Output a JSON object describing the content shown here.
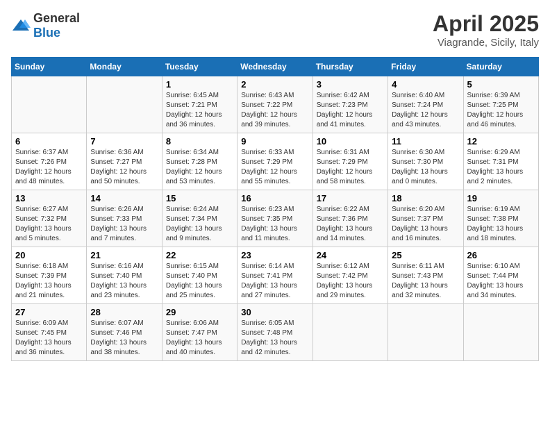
{
  "header": {
    "logo_general": "General",
    "logo_blue": "Blue",
    "title": "April 2025",
    "subtitle": "Viagrande, Sicily, Italy"
  },
  "weekdays": [
    "Sunday",
    "Monday",
    "Tuesday",
    "Wednesday",
    "Thursday",
    "Friday",
    "Saturday"
  ],
  "weeks": [
    [
      {
        "day": "",
        "sunrise": "",
        "sunset": "",
        "daylight": ""
      },
      {
        "day": "",
        "sunrise": "",
        "sunset": "",
        "daylight": ""
      },
      {
        "day": "1",
        "sunrise": "Sunrise: 6:45 AM",
        "sunset": "Sunset: 7:21 PM",
        "daylight": "Daylight: 12 hours and 36 minutes."
      },
      {
        "day": "2",
        "sunrise": "Sunrise: 6:43 AM",
        "sunset": "Sunset: 7:22 PM",
        "daylight": "Daylight: 12 hours and 39 minutes."
      },
      {
        "day": "3",
        "sunrise": "Sunrise: 6:42 AM",
        "sunset": "Sunset: 7:23 PM",
        "daylight": "Daylight: 12 hours and 41 minutes."
      },
      {
        "day": "4",
        "sunrise": "Sunrise: 6:40 AM",
        "sunset": "Sunset: 7:24 PM",
        "daylight": "Daylight: 12 hours and 43 minutes."
      },
      {
        "day": "5",
        "sunrise": "Sunrise: 6:39 AM",
        "sunset": "Sunset: 7:25 PM",
        "daylight": "Daylight: 12 hours and 46 minutes."
      }
    ],
    [
      {
        "day": "6",
        "sunrise": "Sunrise: 6:37 AM",
        "sunset": "Sunset: 7:26 PM",
        "daylight": "Daylight: 12 hours and 48 minutes."
      },
      {
        "day": "7",
        "sunrise": "Sunrise: 6:36 AM",
        "sunset": "Sunset: 7:27 PM",
        "daylight": "Daylight: 12 hours and 50 minutes."
      },
      {
        "day": "8",
        "sunrise": "Sunrise: 6:34 AM",
        "sunset": "Sunset: 7:28 PM",
        "daylight": "Daylight: 12 hours and 53 minutes."
      },
      {
        "day": "9",
        "sunrise": "Sunrise: 6:33 AM",
        "sunset": "Sunset: 7:29 PM",
        "daylight": "Daylight: 12 hours and 55 minutes."
      },
      {
        "day": "10",
        "sunrise": "Sunrise: 6:31 AM",
        "sunset": "Sunset: 7:29 PM",
        "daylight": "Daylight: 12 hours and 58 minutes."
      },
      {
        "day": "11",
        "sunrise": "Sunrise: 6:30 AM",
        "sunset": "Sunset: 7:30 PM",
        "daylight": "Daylight: 13 hours and 0 minutes."
      },
      {
        "day": "12",
        "sunrise": "Sunrise: 6:29 AM",
        "sunset": "Sunset: 7:31 PM",
        "daylight": "Daylight: 13 hours and 2 minutes."
      }
    ],
    [
      {
        "day": "13",
        "sunrise": "Sunrise: 6:27 AM",
        "sunset": "Sunset: 7:32 PM",
        "daylight": "Daylight: 13 hours and 5 minutes."
      },
      {
        "day": "14",
        "sunrise": "Sunrise: 6:26 AM",
        "sunset": "Sunset: 7:33 PM",
        "daylight": "Daylight: 13 hours and 7 minutes."
      },
      {
        "day": "15",
        "sunrise": "Sunrise: 6:24 AM",
        "sunset": "Sunset: 7:34 PM",
        "daylight": "Daylight: 13 hours and 9 minutes."
      },
      {
        "day": "16",
        "sunrise": "Sunrise: 6:23 AM",
        "sunset": "Sunset: 7:35 PM",
        "daylight": "Daylight: 13 hours and 11 minutes."
      },
      {
        "day": "17",
        "sunrise": "Sunrise: 6:22 AM",
        "sunset": "Sunset: 7:36 PM",
        "daylight": "Daylight: 13 hours and 14 minutes."
      },
      {
        "day": "18",
        "sunrise": "Sunrise: 6:20 AM",
        "sunset": "Sunset: 7:37 PM",
        "daylight": "Daylight: 13 hours and 16 minutes."
      },
      {
        "day": "19",
        "sunrise": "Sunrise: 6:19 AM",
        "sunset": "Sunset: 7:38 PM",
        "daylight": "Daylight: 13 hours and 18 minutes."
      }
    ],
    [
      {
        "day": "20",
        "sunrise": "Sunrise: 6:18 AM",
        "sunset": "Sunset: 7:39 PM",
        "daylight": "Daylight: 13 hours and 21 minutes."
      },
      {
        "day": "21",
        "sunrise": "Sunrise: 6:16 AM",
        "sunset": "Sunset: 7:40 PM",
        "daylight": "Daylight: 13 hours and 23 minutes."
      },
      {
        "day": "22",
        "sunrise": "Sunrise: 6:15 AM",
        "sunset": "Sunset: 7:40 PM",
        "daylight": "Daylight: 13 hours and 25 minutes."
      },
      {
        "day": "23",
        "sunrise": "Sunrise: 6:14 AM",
        "sunset": "Sunset: 7:41 PM",
        "daylight": "Daylight: 13 hours and 27 minutes."
      },
      {
        "day": "24",
        "sunrise": "Sunrise: 6:12 AM",
        "sunset": "Sunset: 7:42 PM",
        "daylight": "Daylight: 13 hours and 29 minutes."
      },
      {
        "day": "25",
        "sunrise": "Sunrise: 6:11 AM",
        "sunset": "Sunset: 7:43 PM",
        "daylight": "Daylight: 13 hours and 32 minutes."
      },
      {
        "day": "26",
        "sunrise": "Sunrise: 6:10 AM",
        "sunset": "Sunset: 7:44 PM",
        "daylight": "Daylight: 13 hours and 34 minutes."
      }
    ],
    [
      {
        "day": "27",
        "sunrise": "Sunrise: 6:09 AM",
        "sunset": "Sunset: 7:45 PM",
        "daylight": "Daylight: 13 hours and 36 minutes."
      },
      {
        "day": "28",
        "sunrise": "Sunrise: 6:07 AM",
        "sunset": "Sunset: 7:46 PM",
        "daylight": "Daylight: 13 hours and 38 minutes."
      },
      {
        "day": "29",
        "sunrise": "Sunrise: 6:06 AM",
        "sunset": "Sunset: 7:47 PM",
        "daylight": "Daylight: 13 hours and 40 minutes."
      },
      {
        "day": "30",
        "sunrise": "Sunrise: 6:05 AM",
        "sunset": "Sunset: 7:48 PM",
        "daylight": "Daylight: 13 hours and 42 minutes."
      },
      {
        "day": "",
        "sunrise": "",
        "sunset": "",
        "daylight": ""
      },
      {
        "day": "",
        "sunrise": "",
        "sunset": "",
        "daylight": ""
      },
      {
        "day": "",
        "sunrise": "",
        "sunset": "",
        "daylight": ""
      }
    ]
  ]
}
